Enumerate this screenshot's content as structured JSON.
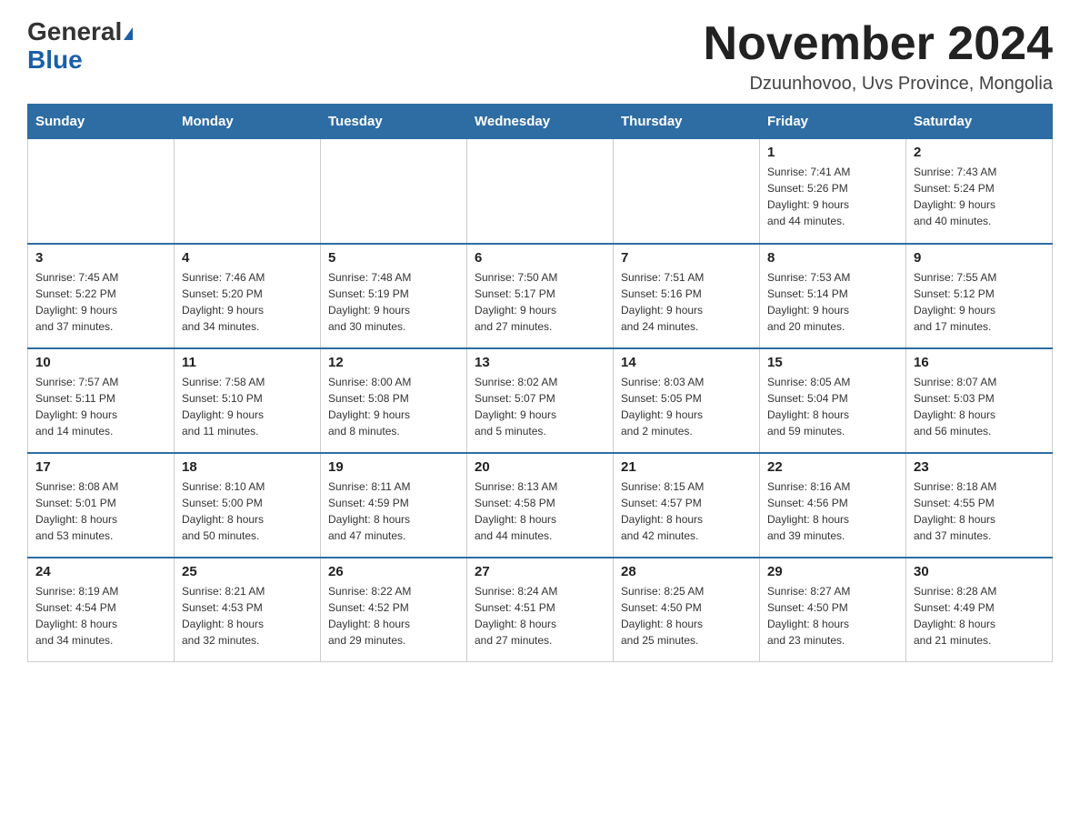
{
  "header": {
    "logo_line1": "General",
    "logo_line2": "Blue",
    "month_title": "November 2024",
    "location": "Dzuunhovoo, Uvs Province, Mongolia"
  },
  "weekdays": [
    "Sunday",
    "Monday",
    "Tuesday",
    "Wednesday",
    "Thursday",
    "Friday",
    "Saturday"
  ],
  "weeks": [
    [
      {
        "day": "",
        "info": ""
      },
      {
        "day": "",
        "info": ""
      },
      {
        "day": "",
        "info": ""
      },
      {
        "day": "",
        "info": ""
      },
      {
        "day": "",
        "info": ""
      },
      {
        "day": "1",
        "info": "Sunrise: 7:41 AM\nSunset: 5:26 PM\nDaylight: 9 hours\nand 44 minutes."
      },
      {
        "day": "2",
        "info": "Sunrise: 7:43 AM\nSunset: 5:24 PM\nDaylight: 9 hours\nand 40 minutes."
      }
    ],
    [
      {
        "day": "3",
        "info": "Sunrise: 7:45 AM\nSunset: 5:22 PM\nDaylight: 9 hours\nand 37 minutes."
      },
      {
        "day": "4",
        "info": "Sunrise: 7:46 AM\nSunset: 5:20 PM\nDaylight: 9 hours\nand 34 minutes."
      },
      {
        "day": "5",
        "info": "Sunrise: 7:48 AM\nSunset: 5:19 PM\nDaylight: 9 hours\nand 30 minutes."
      },
      {
        "day": "6",
        "info": "Sunrise: 7:50 AM\nSunset: 5:17 PM\nDaylight: 9 hours\nand 27 minutes."
      },
      {
        "day": "7",
        "info": "Sunrise: 7:51 AM\nSunset: 5:16 PM\nDaylight: 9 hours\nand 24 minutes."
      },
      {
        "day": "8",
        "info": "Sunrise: 7:53 AM\nSunset: 5:14 PM\nDaylight: 9 hours\nand 20 minutes."
      },
      {
        "day": "9",
        "info": "Sunrise: 7:55 AM\nSunset: 5:12 PM\nDaylight: 9 hours\nand 17 minutes."
      }
    ],
    [
      {
        "day": "10",
        "info": "Sunrise: 7:57 AM\nSunset: 5:11 PM\nDaylight: 9 hours\nand 14 minutes."
      },
      {
        "day": "11",
        "info": "Sunrise: 7:58 AM\nSunset: 5:10 PM\nDaylight: 9 hours\nand 11 minutes."
      },
      {
        "day": "12",
        "info": "Sunrise: 8:00 AM\nSunset: 5:08 PM\nDaylight: 9 hours\nand 8 minutes."
      },
      {
        "day": "13",
        "info": "Sunrise: 8:02 AM\nSunset: 5:07 PM\nDaylight: 9 hours\nand 5 minutes."
      },
      {
        "day": "14",
        "info": "Sunrise: 8:03 AM\nSunset: 5:05 PM\nDaylight: 9 hours\nand 2 minutes."
      },
      {
        "day": "15",
        "info": "Sunrise: 8:05 AM\nSunset: 5:04 PM\nDaylight: 8 hours\nand 59 minutes."
      },
      {
        "day": "16",
        "info": "Sunrise: 8:07 AM\nSunset: 5:03 PM\nDaylight: 8 hours\nand 56 minutes."
      }
    ],
    [
      {
        "day": "17",
        "info": "Sunrise: 8:08 AM\nSunset: 5:01 PM\nDaylight: 8 hours\nand 53 minutes."
      },
      {
        "day": "18",
        "info": "Sunrise: 8:10 AM\nSunset: 5:00 PM\nDaylight: 8 hours\nand 50 minutes."
      },
      {
        "day": "19",
        "info": "Sunrise: 8:11 AM\nSunset: 4:59 PM\nDaylight: 8 hours\nand 47 minutes."
      },
      {
        "day": "20",
        "info": "Sunrise: 8:13 AM\nSunset: 4:58 PM\nDaylight: 8 hours\nand 44 minutes."
      },
      {
        "day": "21",
        "info": "Sunrise: 8:15 AM\nSunset: 4:57 PM\nDaylight: 8 hours\nand 42 minutes."
      },
      {
        "day": "22",
        "info": "Sunrise: 8:16 AM\nSunset: 4:56 PM\nDaylight: 8 hours\nand 39 minutes."
      },
      {
        "day": "23",
        "info": "Sunrise: 8:18 AM\nSunset: 4:55 PM\nDaylight: 8 hours\nand 37 minutes."
      }
    ],
    [
      {
        "day": "24",
        "info": "Sunrise: 8:19 AM\nSunset: 4:54 PM\nDaylight: 8 hours\nand 34 minutes."
      },
      {
        "day": "25",
        "info": "Sunrise: 8:21 AM\nSunset: 4:53 PM\nDaylight: 8 hours\nand 32 minutes."
      },
      {
        "day": "26",
        "info": "Sunrise: 8:22 AM\nSunset: 4:52 PM\nDaylight: 8 hours\nand 29 minutes."
      },
      {
        "day": "27",
        "info": "Sunrise: 8:24 AM\nSunset: 4:51 PM\nDaylight: 8 hours\nand 27 minutes."
      },
      {
        "day": "28",
        "info": "Sunrise: 8:25 AM\nSunset: 4:50 PM\nDaylight: 8 hours\nand 25 minutes."
      },
      {
        "day": "29",
        "info": "Sunrise: 8:27 AM\nSunset: 4:50 PM\nDaylight: 8 hours\nand 23 minutes."
      },
      {
        "day": "30",
        "info": "Sunrise: 8:28 AM\nSunset: 4:49 PM\nDaylight: 8 hours\nand 21 minutes."
      }
    ]
  ]
}
